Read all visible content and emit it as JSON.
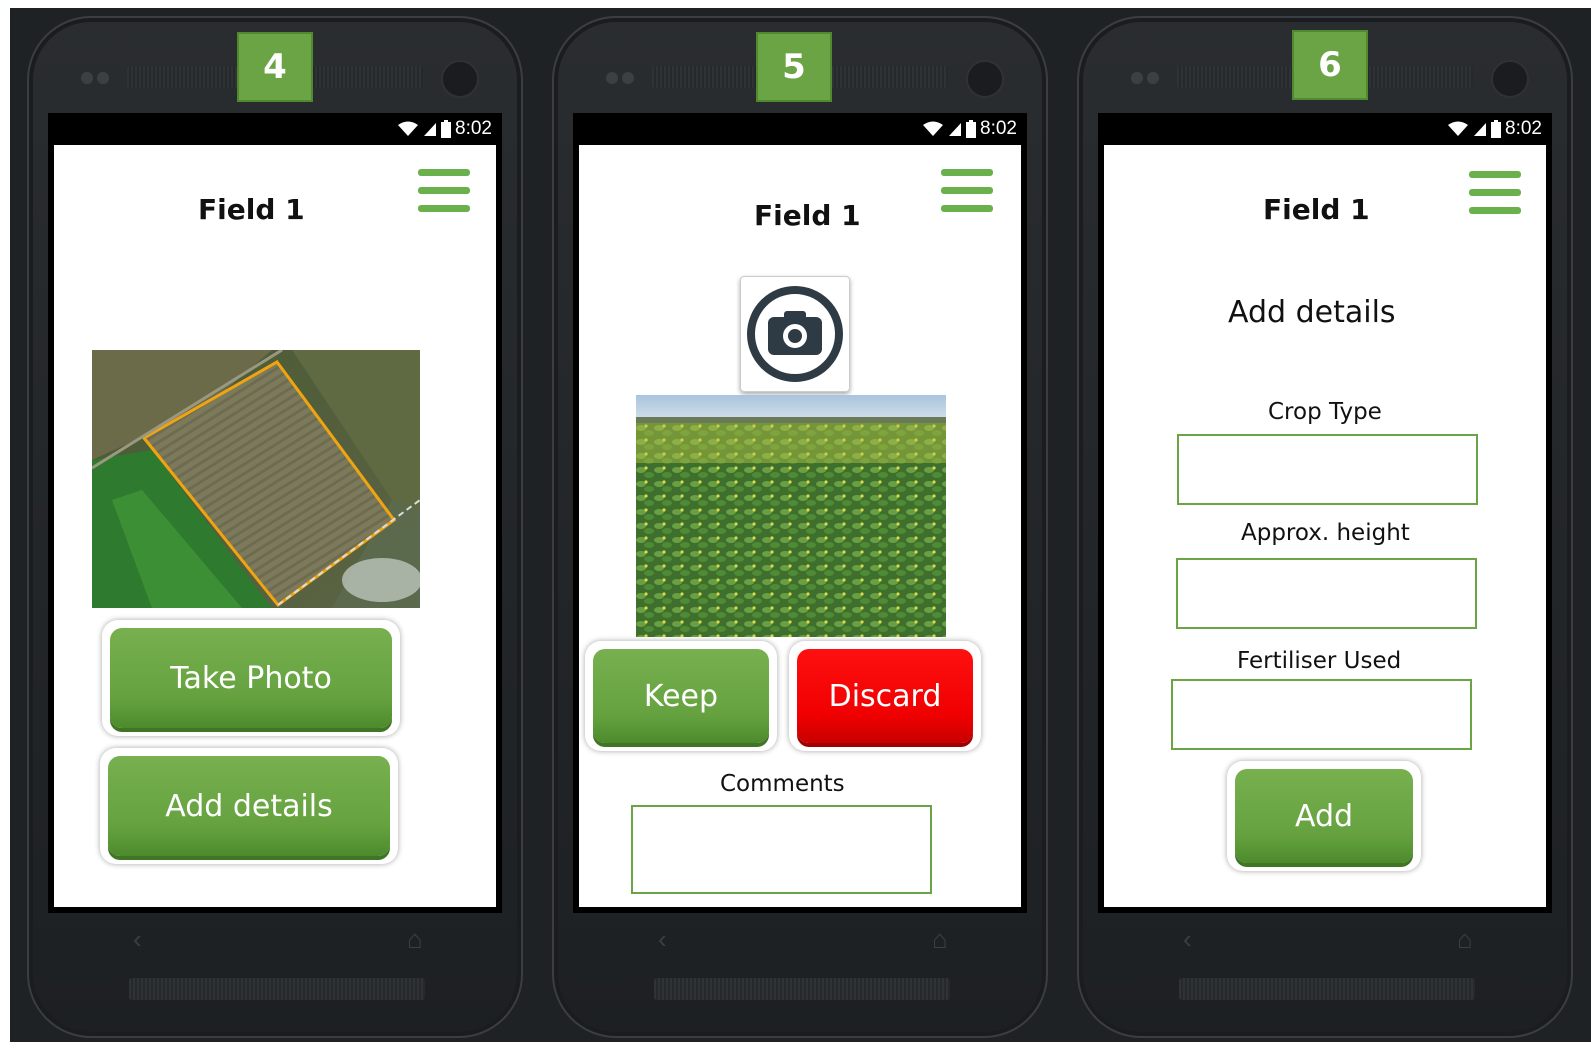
{
  "status_time": "8:02",
  "screens": [
    {
      "step": "4",
      "title": "Field 1",
      "map_image": "aerial-field-map",
      "buttons": {
        "take_photo": "Take Photo",
        "add_details": "Add details"
      }
    },
    {
      "step": "5",
      "title": "Field 1",
      "photo_image": "crop-field-photo",
      "buttons": {
        "keep": "Keep",
        "discard": "Discard"
      },
      "comments_label": "Comments",
      "comments_value": ""
    },
    {
      "step": "6",
      "title": "Field 1",
      "heading": "Add details",
      "fields": [
        {
          "label": "Crop Type",
          "value": ""
        },
        {
          "label": "Approx. height",
          "value": ""
        },
        {
          "label": "Fertiliser Used",
          "value": ""
        }
      ],
      "add_button": "Add"
    }
  ],
  "colors": {
    "accent_green": "#6aa444",
    "discard_red": "#f00000",
    "phone_body": "#222528"
  },
  "icons": [
    "wifi-icon",
    "signal-icon",
    "battery-icon",
    "menu-icon",
    "camera-icon",
    "back-icon",
    "home-icon"
  ]
}
